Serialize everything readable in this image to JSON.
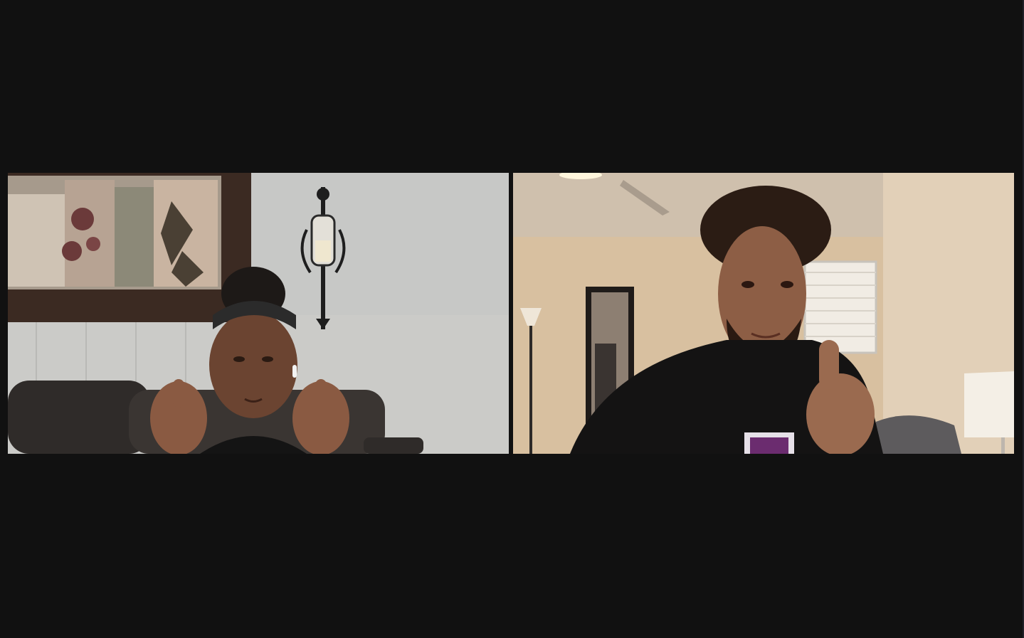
{
  "app": {
    "view_mode": "gallery-view",
    "background_color": "#111111"
  },
  "participants": [
    {
      "id": "participant-1",
      "video_on": true,
      "gesture": "thumbs-up",
      "scene": "living-room",
      "wall_color": "#c9cac9"
    },
    {
      "id": "participant-2",
      "video_on": true,
      "gesture": "thumbs-up",
      "scene": "bedroom",
      "wall_color": "#d9c1a1"
    }
  ]
}
